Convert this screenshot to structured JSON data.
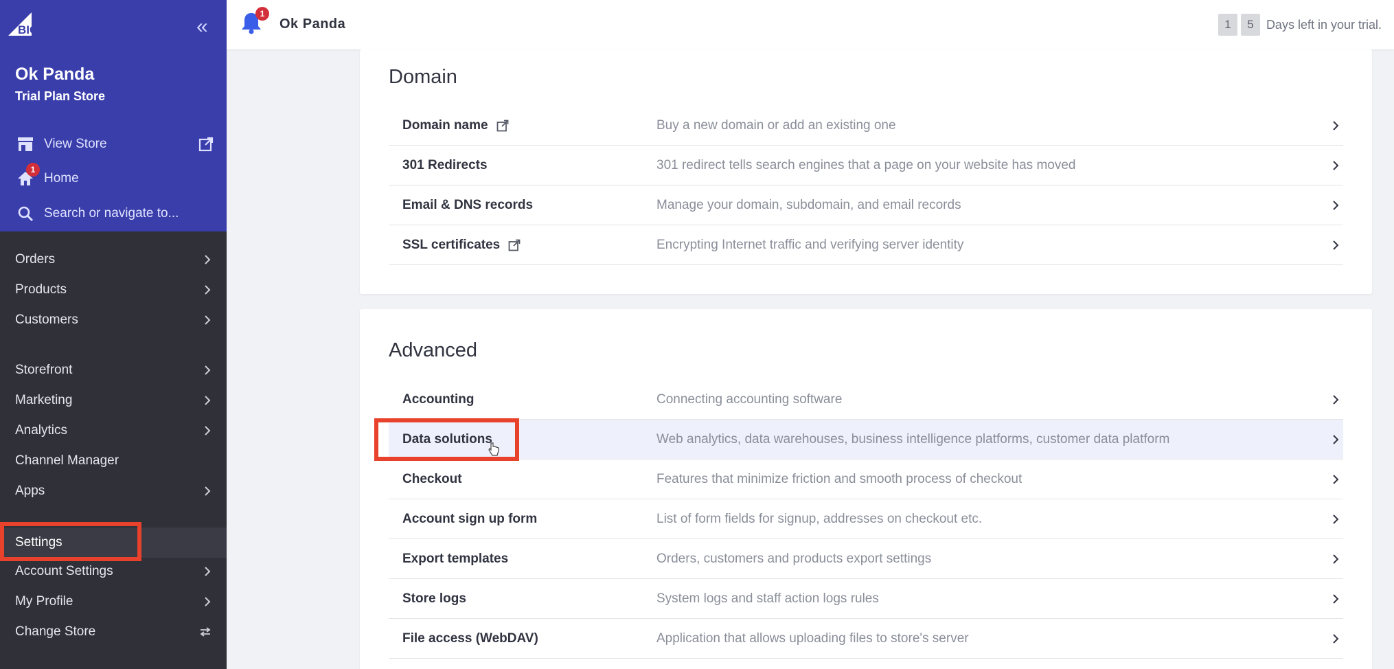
{
  "app": {
    "logo_text": "BIGCOMMERCE",
    "store_name": "Ok Panda",
    "store_plan": "Trial Plan Store"
  },
  "sidebar_top": {
    "view_store": "View Store",
    "home": "Home",
    "home_badge": "1",
    "search_placeholder": "Search or navigate to..."
  },
  "nav": {
    "items": [
      {
        "label": "Orders"
      },
      {
        "label": "Products"
      },
      {
        "label": "Customers"
      },
      {
        "label": "Storefront"
      },
      {
        "label": "Marketing"
      },
      {
        "label": "Analytics"
      },
      {
        "label": "Channel Manager"
      },
      {
        "label": "Apps"
      },
      {
        "label": "Settings"
      },
      {
        "label": "Account Settings"
      },
      {
        "label": "My Profile"
      },
      {
        "label": "Change Store"
      }
    ]
  },
  "header": {
    "notification_count": "1",
    "title": "Ok Panda",
    "trial_digit_1": "1",
    "trial_digit_2": "5",
    "trial_text": "Days left in your trial."
  },
  "domain_section": {
    "title": "Domain",
    "rows": [
      {
        "label": "Domain name",
        "desc": "Buy a new domain or add an existing one"
      },
      {
        "label": "301 Redirects",
        "desc": "301 redirect tells search engines that a page on your website has moved"
      },
      {
        "label": "Email & DNS records",
        "desc": "Manage your domain, subdomain, and email records"
      },
      {
        "label": "SSL certificates",
        "desc": "Encrypting Internet traffic and verifying server identity"
      }
    ]
  },
  "advanced_section": {
    "title": "Advanced",
    "rows": [
      {
        "label": "Accounting",
        "desc": "Connecting accounting software"
      },
      {
        "label": "Data solutions",
        "desc": "Web analytics, data warehouses, business intelligence platforms, customer data platform"
      },
      {
        "label": "Checkout",
        "desc": "Features that minimize friction and smooth process of checkout"
      },
      {
        "label": "Account sign up form",
        "desc": "List of form fields for signup, addresses on checkout etc."
      },
      {
        "label": "Export templates",
        "desc": "Orders, customers and products export settings"
      },
      {
        "label": "Store logs",
        "desc": "System logs and staff action logs rules"
      },
      {
        "label": "File access (WebDAV)",
        "desc": "Application that allows uploading files to store's server"
      }
    ]
  },
  "colors": {
    "sidebar_top": "#3a3eaa",
    "sidebar": "#2f3038",
    "highlight": "#e8412c",
    "badge": "#d32f3a"
  }
}
